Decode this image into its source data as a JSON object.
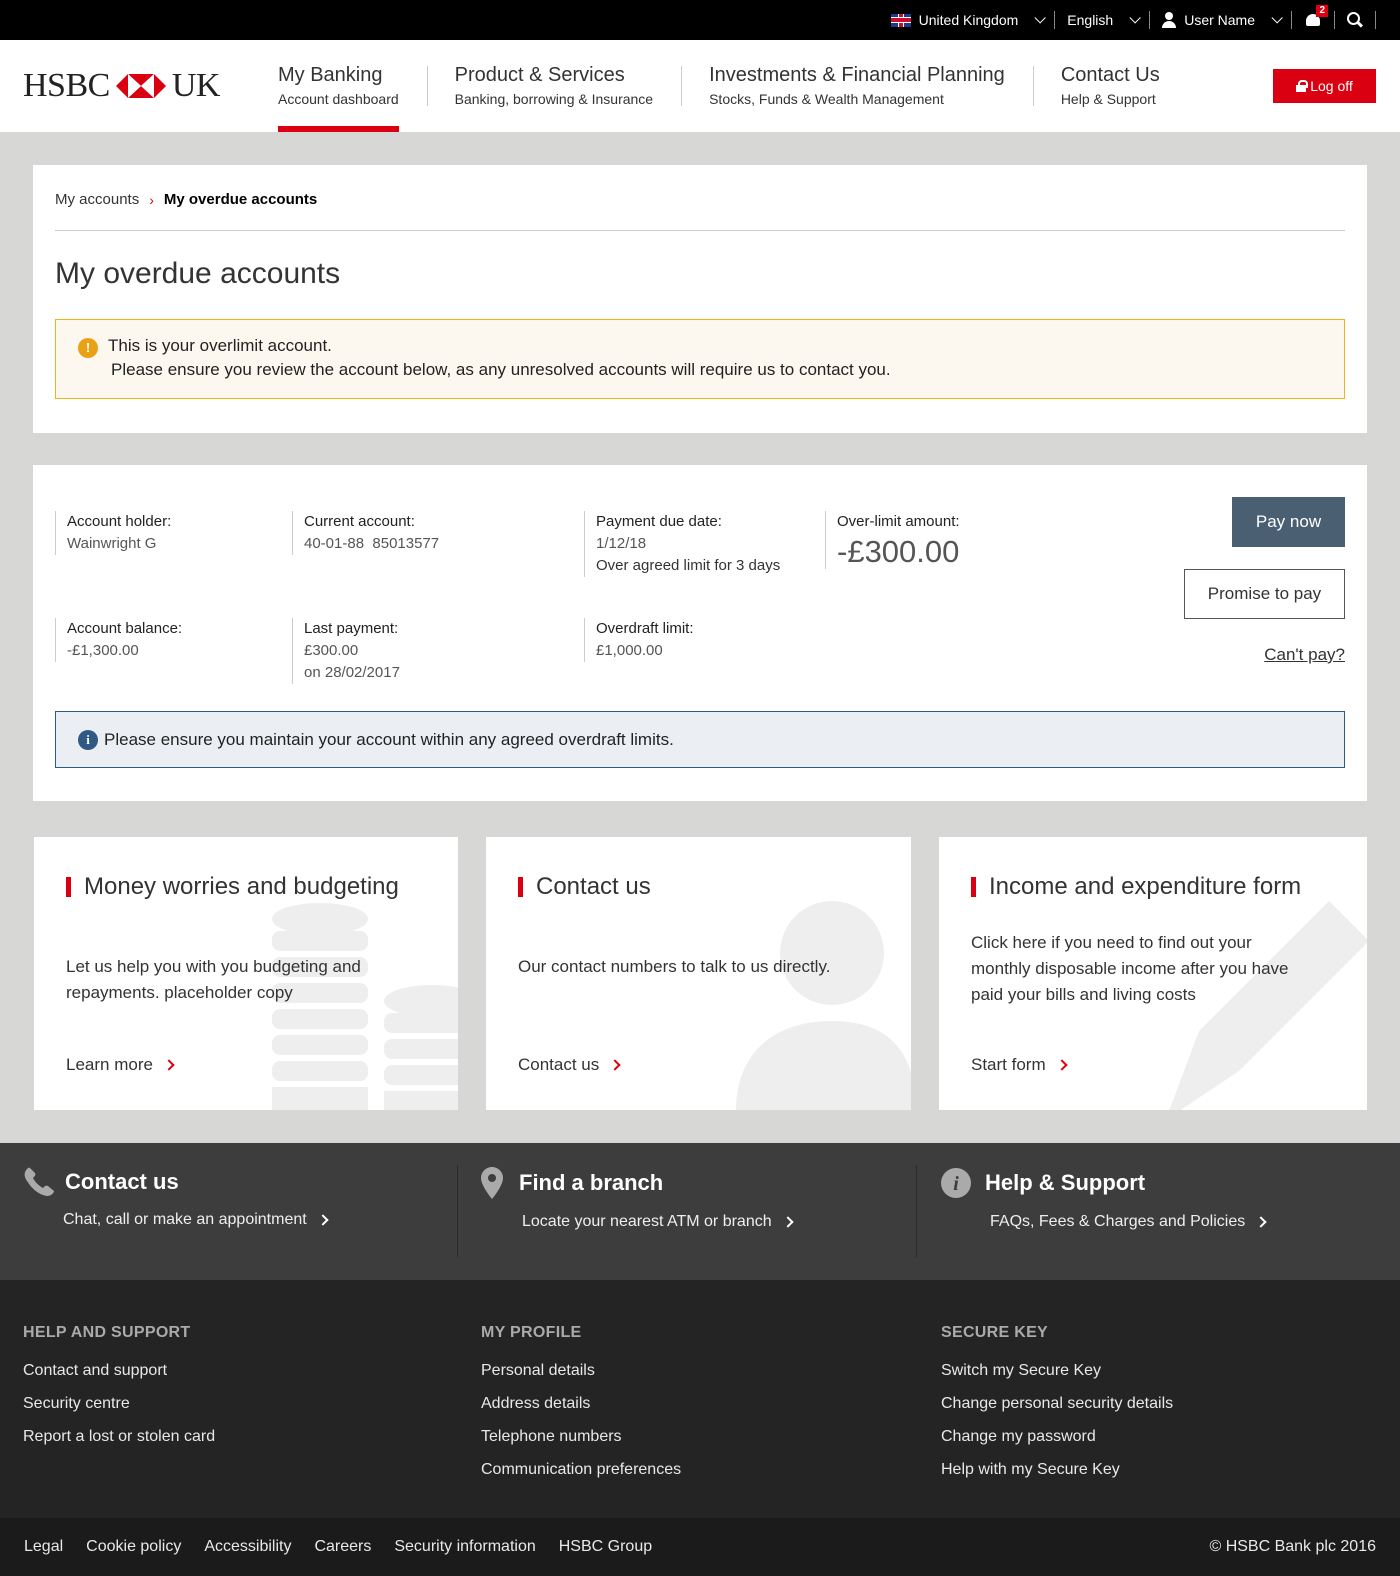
{
  "topbar": {
    "country": "United Kingdom",
    "language": "English",
    "user": "User Name",
    "notifications": "2"
  },
  "brand": {
    "left": "HSBC",
    "right": "UK"
  },
  "nav": [
    {
      "title": "My Banking",
      "sub": "Account dashboard"
    },
    {
      "title": "Product & Services",
      "sub": "Banking, borrowing & Insurance"
    },
    {
      "title": "Investments & Financial Planning",
      "sub": "Stocks, Funds & Wealth Management"
    },
    {
      "title": "Contact Us",
      "sub": "Help & Support"
    }
  ],
  "logoff": "Log off",
  "breadcrumb": {
    "parent": "My accounts",
    "current": "My overdue accounts"
  },
  "page_title": "My overdue accounts",
  "warning": {
    "title": "This is your overlimit account.",
    "text": "Please ensure you review the account below, as any unresolved accounts will require us to contact you."
  },
  "account": {
    "holder_label": "Account holder:",
    "holder": "Wainwright G",
    "current_label": "Current account:",
    "current": "40-01-88  85013577",
    "due_label": "Payment due date:",
    "due": "1/12/18",
    "due_note": "Over agreed limit for 3 days",
    "overlimit_label": "Over-limit amount:",
    "overlimit": "-£300.00",
    "balance_label": "Account balance:",
    "balance": "-£1,300.00",
    "lastpay_label": "Last payment:",
    "lastpay": "£300.00",
    "lastpay_date": "on 28/02/2017",
    "overdraft_label": "Overdraft limit:",
    "overdraft": "£1,000.00"
  },
  "actions": {
    "pay": "Pay now",
    "promise": "Promise to pay",
    "cant": "Can't pay?"
  },
  "info": "Please ensure you maintain your account within any agreed overdraft limits.",
  "cards": [
    {
      "title": "Money worries and budgeting",
      "body1": "Let us help you with you budgeting and",
      "body2": "repayments. placeholder copy",
      "link": "Learn more"
    },
    {
      "title": "Contact us",
      "body1": "Our contact numbers to talk to us directly.",
      "link": "Contact us"
    },
    {
      "title": "Income and expenditure form",
      "body1": "Click here if you need to find out your",
      "body2": "monthly disposable income after you have",
      "body3": "paid your bills and living costs",
      "link": "Start form"
    }
  ],
  "footstrip": [
    {
      "title": "Contact us",
      "sub": "Chat, call or make an appointment"
    },
    {
      "title": "Find a branch",
      "sub": "Locate your nearest ATM or branch"
    },
    {
      "title": "Help & Support",
      "sub": "FAQs, Fees & Charges and Policies"
    }
  ],
  "footlinks": [
    {
      "heading": "HELP AND SUPPORT",
      "items": [
        "Contact and support",
        "Security centre",
        "Report a lost or stolen card"
      ]
    },
    {
      "heading": "MY PROFILE",
      "items": [
        "Personal details",
        "Address details",
        "Telephone numbers",
        "Communication preferences"
      ]
    },
    {
      "heading": "SECURE KEY",
      "items": [
        "Switch my Secure Key",
        "Change personal security details",
        "Change my password",
        "Help with my Secure Key"
      ]
    }
  ],
  "bottom": {
    "links": [
      "Legal",
      "Cookie policy",
      "Accessibility",
      "Careers",
      "Security information",
      "HSBC Group"
    ],
    "copyright": "© HSBC Bank plc 2016"
  },
  "colors": {
    "brand_red": "#db0011",
    "pay_button": "#4b5f73",
    "warning_border": "#f0b41b",
    "info_border": "#305a85"
  }
}
